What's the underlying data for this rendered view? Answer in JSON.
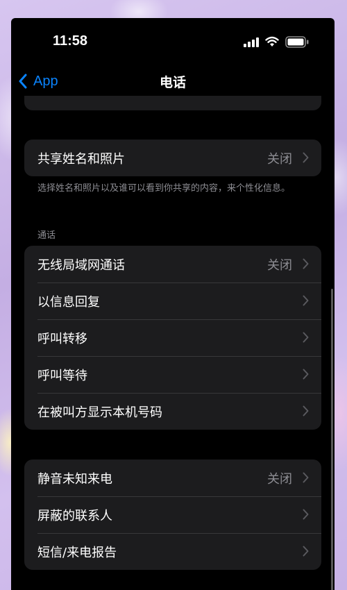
{
  "status_bar": {
    "time": "11:58",
    "icons": [
      "signal-icon",
      "wifi-icon",
      "battery-icon"
    ]
  },
  "nav": {
    "back_label": "App",
    "title": "电话"
  },
  "group_share": {
    "row": {
      "label": "共享姓名和照片",
      "value": "关闭"
    },
    "footnote": "选择姓名和照片以及谁可以看到你共享的内容，来个性化信息。"
  },
  "section_calls": {
    "header": "通话",
    "rows": [
      {
        "label": "无线局域网通话",
        "value": "关闭"
      },
      {
        "label": "以信息回复",
        "value": ""
      },
      {
        "label": "呼叫转移",
        "value": ""
      },
      {
        "label": "呼叫等待",
        "value": ""
      },
      {
        "label": "在被叫方显示本机号码",
        "value": ""
      }
    ]
  },
  "section_block": {
    "rows": [
      {
        "label": "静音未知来电",
        "value": "关闭"
      },
      {
        "label": "屏蔽的联系人",
        "value": ""
      },
      {
        "label": "短信/来电报告",
        "value": ""
      }
    ]
  },
  "colors": {
    "accent": "#0a84ff",
    "background": "#000000",
    "cell": "#1c1c1e",
    "secondary_text": "#8d8d93"
  }
}
